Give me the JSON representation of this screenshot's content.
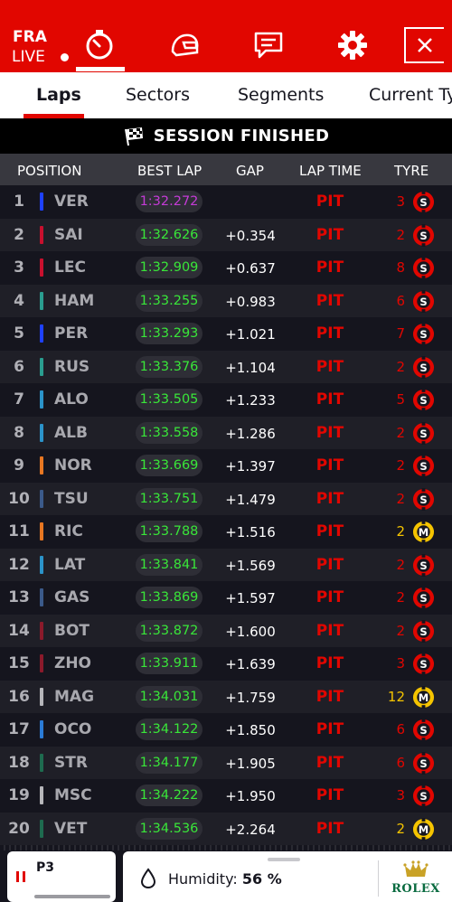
{
  "session": {
    "circuit_code": "FRA",
    "live_label": "LIVE"
  },
  "nav": {
    "icons": [
      "timer-icon",
      "helmet-icon",
      "chat-icon",
      "gear-icon",
      "close-icon"
    ],
    "active": "timer-icon"
  },
  "tabs": [
    {
      "label": "Laps",
      "active": true
    },
    {
      "label": "Sectors",
      "active": false
    },
    {
      "label": "Segments",
      "active": false
    },
    {
      "label": "Current Tyre",
      "active": false
    }
  ],
  "banner": {
    "text": "SESSION FINISHED"
  },
  "table": {
    "headers": {
      "position": "POSITION",
      "best_lap": "BEST LAP",
      "gap": "GAP",
      "lap_time": "LAP TIME",
      "tyre": "TYRE"
    },
    "rows": [
      {
        "pos": "1",
        "driver": "VER",
        "team_color": "#1e41ff",
        "best_lap": "1:32.272",
        "best_lap_color": "#c43bd6",
        "gap": "",
        "lap_time": "PIT",
        "tyre_age": "3",
        "tyre_compound": "S",
        "tyre_color": "#e10600"
      },
      {
        "pos": "2",
        "driver": "SAI",
        "team_color": "#c8102e",
        "best_lap": "1:32.626",
        "best_lap_color": "#39e639",
        "gap": "+0.354",
        "lap_time": "PIT",
        "tyre_age": "2",
        "tyre_compound": "S",
        "tyre_color": "#e10600"
      },
      {
        "pos": "3",
        "driver": "LEC",
        "team_color": "#c8102e",
        "best_lap": "1:32.909",
        "best_lap_color": "#39e639",
        "gap": "+0.637",
        "lap_time": "PIT",
        "tyre_age": "8",
        "tyre_compound": "S",
        "tyre_color": "#e10600"
      },
      {
        "pos": "4",
        "driver": "HAM",
        "team_color": "#2a9d8f",
        "best_lap": "1:33.255",
        "best_lap_color": "#39e639",
        "gap": "+0.983",
        "lap_time": "PIT",
        "tyre_age": "6",
        "tyre_compound": "S",
        "tyre_color": "#e10600"
      },
      {
        "pos": "5",
        "driver": "PER",
        "team_color": "#1e41ff",
        "best_lap": "1:33.293",
        "best_lap_color": "#39e639",
        "gap": "+1.021",
        "lap_time": "PIT",
        "tyre_age": "7",
        "tyre_compound": "S",
        "tyre_color": "#e10600"
      },
      {
        "pos": "6",
        "driver": "RUS",
        "team_color": "#2a9d8f",
        "best_lap": "1:33.376",
        "best_lap_color": "#39e639",
        "gap": "+1.104",
        "lap_time": "PIT",
        "tyre_age": "2",
        "tyre_compound": "S",
        "tyre_color": "#e10600"
      },
      {
        "pos": "7",
        "driver": "ALO",
        "team_color": "#2b93c9",
        "best_lap": "1:33.505",
        "best_lap_color": "#39e639",
        "gap": "+1.233",
        "lap_time": "PIT",
        "tyre_age": "5",
        "tyre_compound": "S",
        "tyre_color": "#e10600"
      },
      {
        "pos": "8",
        "driver": "ALB",
        "team_color": "#2b93c9",
        "best_lap": "1:33.558",
        "best_lap_color": "#39e639",
        "gap": "+1.286",
        "lap_time": "PIT",
        "tyre_age": "2",
        "tyre_compound": "S",
        "tyre_color": "#e10600"
      },
      {
        "pos": "9",
        "driver": "NOR",
        "team_color": "#e87722",
        "best_lap": "1:33.669",
        "best_lap_color": "#39e639",
        "gap": "+1.397",
        "lap_time": "PIT",
        "tyre_age": "2",
        "tyre_compound": "S",
        "tyre_color": "#e10600"
      },
      {
        "pos": "10",
        "driver": "TSU",
        "team_color": "#3b5a8a",
        "best_lap": "1:33.751",
        "best_lap_color": "#39e639",
        "gap": "+1.479",
        "lap_time": "PIT",
        "tyre_age": "2",
        "tyre_compound": "S",
        "tyre_color": "#e10600"
      },
      {
        "pos": "11",
        "driver": "RIC",
        "team_color": "#e87722",
        "best_lap": "1:33.788",
        "best_lap_color": "#39e639",
        "gap": "+1.516",
        "lap_time": "PIT",
        "tyre_age": "2",
        "tyre_compound": "M",
        "tyre_color": "#f5c400"
      },
      {
        "pos": "12",
        "driver": "LAT",
        "team_color": "#2b93c9",
        "best_lap": "1:33.841",
        "best_lap_color": "#39e639",
        "gap": "+1.569",
        "lap_time": "PIT",
        "tyre_age": "2",
        "tyre_compound": "S",
        "tyre_color": "#e10600"
      },
      {
        "pos": "13",
        "driver": "GAS",
        "team_color": "#3b5a8a",
        "best_lap": "1:33.869",
        "best_lap_color": "#39e639",
        "gap": "+1.597",
        "lap_time": "PIT",
        "tyre_age": "2",
        "tyre_compound": "S",
        "tyre_color": "#e10600"
      },
      {
        "pos": "14",
        "driver": "BOT",
        "team_color": "#8b1a2b",
        "best_lap": "1:33.872",
        "best_lap_color": "#39e639",
        "gap": "+1.600",
        "lap_time": "PIT",
        "tyre_age": "2",
        "tyre_compound": "S",
        "tyre_color": "#e10600"
      },
      {
        "pos": "15",
        "driver": "ZHO",
        "team_color": "#8b1a2b",
        "best_lap": "1:33.911",
        "best_lap_color": "#39e639",
        "gap": "+1.639",
        "lap_time": "PIT",
        "tyre_age": "3",
        "tyre_compound": "S",
        "tyre_color": "#e10600"
      },
      {
        "pos": "16",
        "driver": "MAG",
        "team_color": "#b6b6ba",
        "best_lap": "1:34.031",
        "best_lap_color": "#39e639",
        "gap": "+1.759",
        "lap_time": "PIT",
        "tyre_age": "12",
        "tyre_compound": "M",
        "tyre_color": "#f5c400"
      },
      {
        "pos": "17",
        "driver": "OCO",
        "team_color": "#2b7bd6",
        "best_lap": "1:34.122",
        "best_lap_color": "#39e639",
        "gap": "+1.850",
        "lap_time": "PIT",
        "tyre_age": "6",
        "tyre_compound": "S",
        "tyre_color": "#e10600"
      },
      {
        "pos": "18",
        "driver": "STR",
        "team_color": "#1e6b4f",
        "best_lap": "1:34.177",
        "best_lap_color": "#39e639",
        "gap": "+1.905",
        "lap_time": "PIT",
        "tyre_age": "6",
        "tyre_compound": "S",
        "tyre_color": "#e10600"
      },
      {
        "pos": "19",
        "driver": "MSC",
        "team_color": "#b6b6ba",
        "best_lap": "1:34.222",
        "best_lap_color": "#39e639",
        "gap": "+1.950",
        "lap_time": "PIT",
        "tyre_age": "3",
        "tyre_compound": "S",
        "tyre_color": "#e10600"
      },
      {
        "pos": "20",
        "driver": "VET",
        "team_color": "#1e6b4f",
        "best_lap": "1:34.536",
        "best_lap_color": "#39e639",
        "gap": "+2.264",
        "lap_time": "PIT",
        "tyre_age": "2",
        "tyre_compound": "M",
        "tyre_color": "#f5c400"
      }
    ]
  },
  "bottom": {
    "session_badge": "P3",
    "humidity_label": "Humidity:",
    "humidity_value": "56 %",
    "sponsor": "ROLEX"
  }
}
